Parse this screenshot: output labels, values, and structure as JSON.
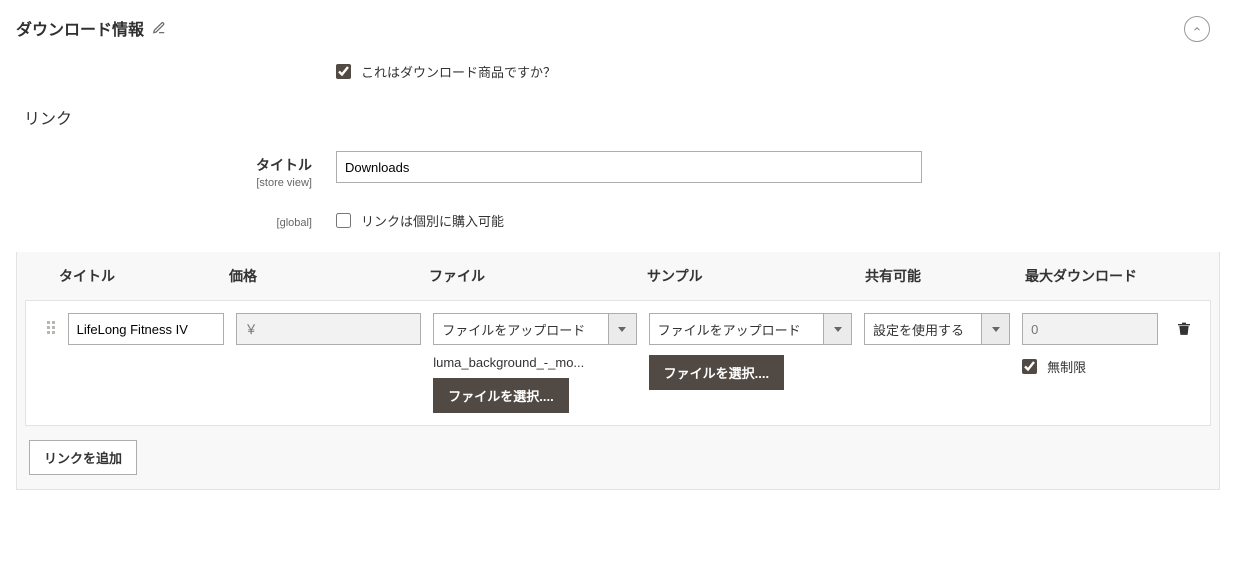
{
  "section": {
    "title": "ダウンロード情報"
  },
  "downloadable": {
    "label": "これはダウンロード商品ですか？",
    "checked": true
  },
  "links_section": {
    "heading": "リンク",
    "title_label": "タイトル",
    "title_scope": "[store view]",
    "title_value": "Downloads",
    "purchasable_label": "リンクは個別に購入可能",
    "purchasable_scope": "[global]",
    "purchasable_checked": false
  },
  "columns": {
    "title": "タイトル",
    "price": "価格",
    "file": "ファイル",
    "sample": "サンプル",
    "shareable": "共有可能",
    "max_dl": "最大ダウンロード"
  },
  "row": {
    "title_value": "LifeLong Fitness IV",
    "price_prefix": "￥",
    "price_value": "",
    "file_mode": "ファイルをアップロード",
    "file_name": "luma_background_-_mo...",
    "file_choose": "ファイルを選択....",
    "sample_mode": "ファイルをアップロード",
    "sample_choose": "ファイルを選択....",
    "share_value": "設定を使用する",
    "max_placeholder": "0",
    "unlimited_label": "無制限",
    "unlimited_checked": true
  },
  "add_link": "リンクを追加"
}
